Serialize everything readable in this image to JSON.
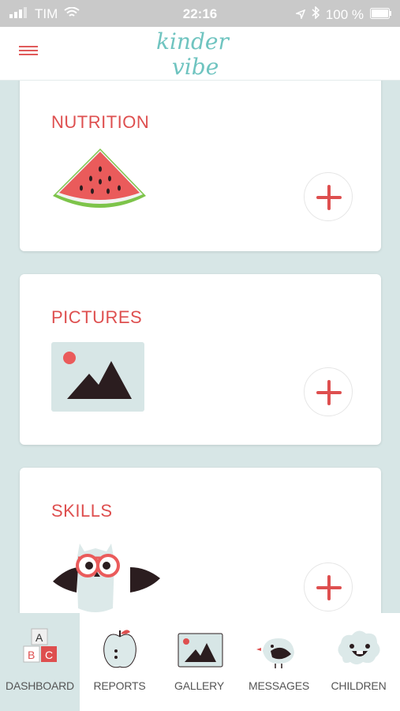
{
  "status_bar": {
    "carrier": "TIM",
    "time": "22:16",
    "battery": "100 %"
  },
  "header": {
    "logo_text_line1": "kinder",
    "logo_text_line2": "vibe",
    "brand_color": "#6fc4c0"
  },
  "cards": [
    {
      "title": "NUTRITION"
    },
    {
      "title": "PICTURES"
    },
    {
      "title": "SKILLS"
    }
  ],
  "tabs": [
    {
      "label": "DASHBOARD",
      "icon": "abc-blocks-icon",
      "active": true
    },
    {
      "label": "REPORTS",
      "icon": "apple-icon",
      "active": false
    },
    {
      "label": "GALLERY",
      "icon": "picture-icon",
      "active": false
    },
    {
      "label": "MESSAGES",
      "icon": "bird-icon",
      "active": false
    },
    {
      "label": "CHILDREN",
      "icon": "cloud-face-icon",
      "active": false
    }
  ],
  "colors": {
    "accent": "#de4f4f",
    "background": "#d7e6e6",
    "dark": "#2b1d1f"
  }
}
